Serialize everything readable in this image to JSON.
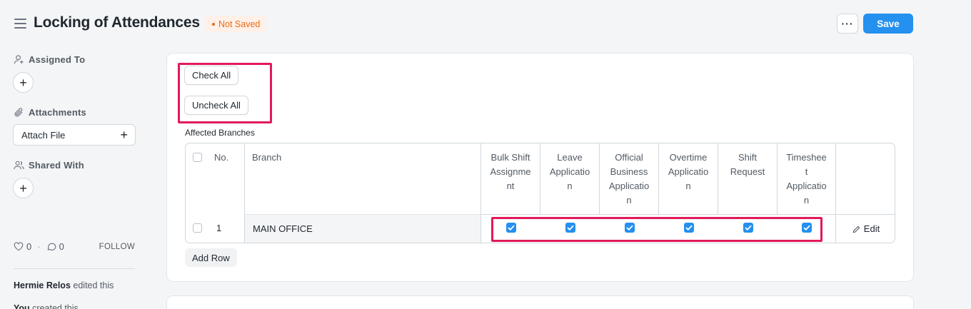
{
  "header": {
    "title": "Locking of Attendances",
    "status": "Not Saved",
    "more_label": "···",
    "save_label": "Save"
  },
  "sidebar": {
    "assigned_to": "Assigned To",
    "attachments": "Attachments",
    "attach_file": "Attach File",
    "shared_with": "Shared With",
    "likes": "0",
    "comments": "0",
    "follow": "FOLLOW",
    "activity": [
      {
        "user": "Hermie Relos",
        "action": "edited this"
      },
      {
        "user": "You",
        "action": "created this"
      }
    ]
  },
  "form": {
    "check_all": "Check All",
    "uncheck_all": "Uncheck All",
    "field_label": "Affected Branches",
    "add_row": "Add Row",
    "edit_label": "Edit"
  },
  "table": {
    "columns": {
      "no": "No.",
      "branch": "Branch",
      "bulk": [
        "Bulk Shift",
        "Assignme",
        "nt"
      ],
      "leave": [
        "Leave",
        "Applicatio",
        "n"
      ],
      "official": [
        "Official",
        "Business",
        "Applicatio",
        "n"
      ],
      "overtime": [
        "Overtime",
        "Applicatio",
        "n"
      ],
      "shift": [
        "Shift",
        "Request"
      ],
      "timesheet": [
        "Timeshee",
        "t",
        "Applicatio",
        "n"
      ]
    },
    "rows": [
      {
        "no": "1",
        "branch": "MAIN OFFICE",
        "bulk_shift_assignment": true,
        "leave_application": true,
        "official_business_application": true,
        "overtime_application": true,
        "shift_request": true,
        "timesheet_application": true
      }
    ]
  },
  "colors": {
    "primary": "#2490ef",
    "highlight": "#e11a5a",
    "status": "#e86c13"
  }
}
